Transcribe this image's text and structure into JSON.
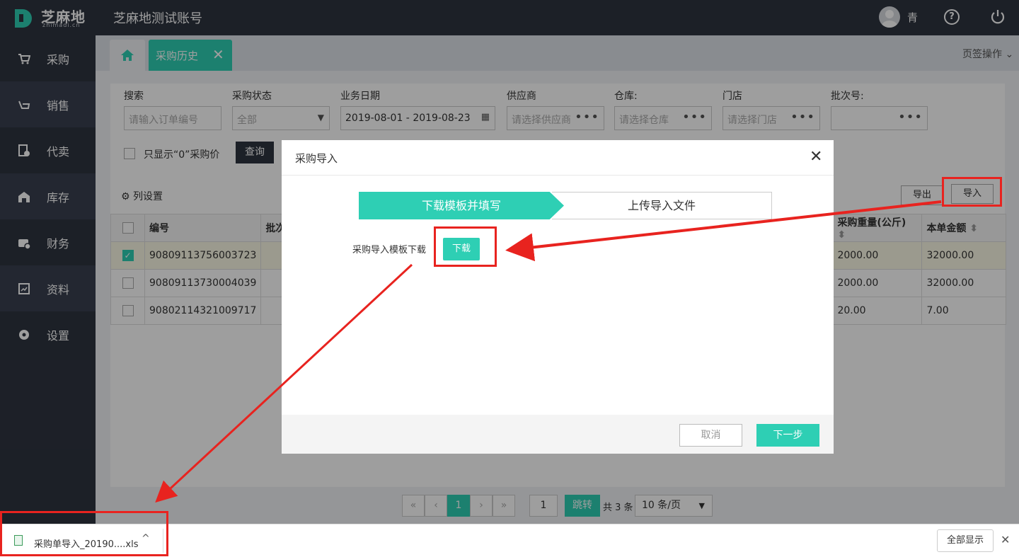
{
  "header": {
    "logo_text": "芝麻地",
    "logo_sub": "zhimadi.cn",
    "account": "芝麻地测试账号",
    "user": "青"
  },
  "sidebar": {
    "items": [
      {
        "label": "采购",
        "icon": "cart-icon"
      },
      {
        "label": "销售",
        "icon": "sales-icon"
      },
      {
        "label": "代卖",
        "icon": "consign-icon"
      },
      {
        "label": "库存",
        "icon": "warehouse-icon"
      },
      {
        "label": "财务",
        "icon": "finance-icon"
      },
      {
        "label": "资料",
        "icon": "data-icon"
      },
      {
        "label": "设置",
        "icon": "gear-icon"
      }
    ]
  },
  "tabs": {
    "active": "采购历史",
    "ops": "页签操作"
  },
  "filters": {
    "search_label": "搜索",
    "search_placeholder": "请输入订单编号",
    "status_label": "采购状态",
    "status_value": "全部",
    "date_label": "业务日期",
    "date_value": "2019-08-01 - 2019-08-23",
    "supplier_label": "供应商",
    "supplier_placeholder": "请选择供应商",
    "warehouse_label": "仓库:",
    "warehouse_placeholder": "请选择仓库",
    "store_label": "门店",
    "store_placeholder": "请选择门店",
    "batch_label": "批次号:",
    "zero_only": "只显示“0”采购价",
    "query": "查询",
    "columns": "列设置",
    "export": "导出",
    "import": "导入"
  },
  "table": {
    "headers": {
      "no": "编号",
      "batch": "批次",
      "weight": "采购重量(公斤)",
      "amount": "本单金额"
    },
    "rows": [
      {
        "no": "90809113756003723",
        "weight": "2000.00",
        "amount": "32000.00"
      },
      {
        "no": "90809113730004039",
        "weight": "2000.00",
        "amount": "32000.00"
      },
      {
        "no": "90802114321009717",
        "weight": "20.00",
        "amount": "7.00"
      }
    ]
  },
  "modal": {
    "title": "采购导入",
    "step1": "下载模板并填写",
    "step2": "上传导入文件",
    "template_label": "采购导入模板下载",
    "download": "下载",
    "cancel": "取消",
    "next": "下一步"
  },
  "pagination": {
    "current": "1",
    "jump_value": "1",
    "jump": "跳转",
    "total": "共 3 条",
    "page_size": "10 条/页"
  },
  "download_bar": {
    "file": "采购单导入_20190....xls",
    "show_all": "全部显示"
  },
  "colors": {
    "accent": "#2ecfb4",
    "dark": "#2e3440",
    "highlight": "#e8231f"
  }
}
